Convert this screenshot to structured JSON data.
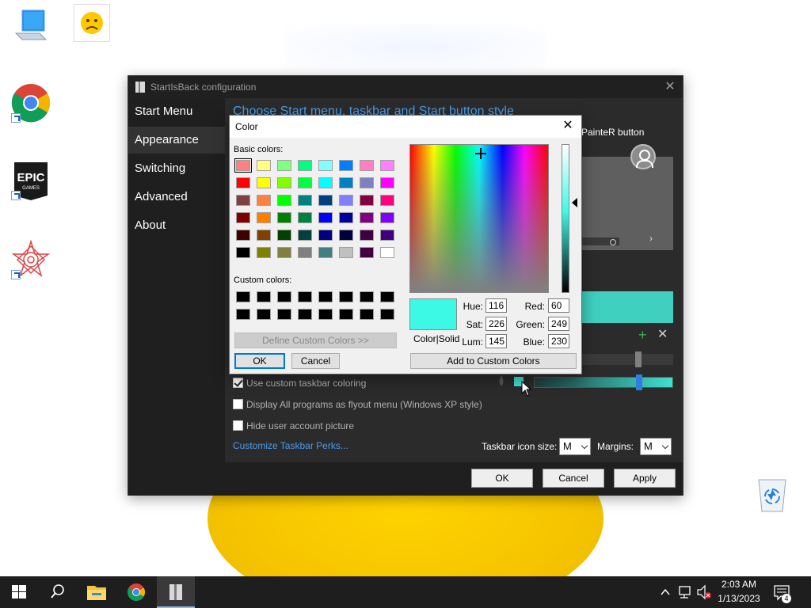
{
  "sib_window": {
    "title": "StartIsBack configuration",
    "close_glyph": "✕",
    "nav": [
      "Start Menu",
      "Appearance",
      "Switching",
      "Advanced",
      "About"
    ],
    "active_nav": "Appearance",
    "heading": "Choose Start menu, taskbar and Start button style",
    "painter_label": "PainteR button",
    "checkboxes": [
      {
        "label": "Use custom taskbar coloring",
        "checked": true
      },
      {
        "label": "Display All programs as flyout menu (Windows XP style)",
        "checked": false
      },
      {
        "label": "Hide user account picture",
        "checked": false
      }
    ],
    "link": "Customize Taskbar Perks...",
    "taskbar_icon_size_label": "Taskbar icon size:",
    "taskbar_icon_size_value": "M",
    "margins_label": "Margins:",
    "margins_value": "M",
    "buttons": {
      "ok": "OK",
      "cancel": "Cancel",
      "apply": "Apply"
    },
    "accent_color": "#3fd0c0"
  },
  "color_dialog": {
    "title": "Color",
    "close_glyph": "✕",
    "basic_colors_label": "Basic colors:",
    "custom_colors_label": "Custom colors:",
    "basic_colors": [
      [
        "#ff8080",
        "#ffff80",
        "#80ff80",
        "#00ff80",
        "#80ffff",
        "#0080ff",
        "#ff80c0",
        "#ff80ff"
      ],
      [
        "#ff0000",
        "#ffff00",
        "#80ff00",
        "#00ff40",
        "#00ffff",
        "#0080c0",
        "#8080c0",
        "#ff00ff"
      ],
      [
        "#804040",
        "#ff8040",
        "#00ff00",
        "#008080",
        "#004080",
        "#8080ff",
        "#800040",
        "#ff0080"
      ],
      [
        "#800000",
        "#ff8000",
        "#008000",
        "#008040",
        "#0000ff",
        "#0000a0",
        "#800080",
        "#8000ff"
      ],
      [
        "#400000",
        "#804000",
        "#004000",
        "#004040",
        "#000080",
        "#000040",
        "#400040",
        "#400080"
      ],
      [
        "#000000",
        "#808000",
        "#808040",
        "#808080",
        "#408080",
        "#c0c0c0",
        "#400040",
        "#ffffff"
      ]
    ],
    "custom_colors": [
      "#000000",
      "#000000",
      "#000000",
      "#000000",
      "#000000",
      "#000000",
      "#000000",
      "#000000",
      "#000000",
      "#000000",
      "#000000",
      "#000000",
      "#000000",
      "#000000",
      "#000000",
      "#000000"
    ],
    "define_custom_button": "Define Custom Colors >>",
    "ok_button": "OK",
    "cancel_button": "Cancel",
    "color_solid_label": "Color|Solid",
    "selected_color": "#3cf9e6",
    "fields": {
      "hue": {
        "label": "Hue:",
        "value": "116"
      },
      "sat": {
        "label": "Sat:",
        "value": "226"
      },
      "lum": {
        "label": "Lum:",
        "value": "145"
      },
      "red": {
        "label": "Red:",
        "value": "60"
      },
      "green": {
        "label": "Green:",
        "value": "249"
      },
      "blue": {
        "label": "Blue:",
        "value": "230"
      }
    },
    "add_custom_button": "Add to Custom Colors"
  },
  "taskbar": {
    "time": "2:03 AM",
    "date": "1/13/2023",
    "notification_count": "4",
    "apps": [
      "start-icon",
      "search-icon",
      "file-explorer-icon",
      "chrome-icon",
      "startisback-icon"
    ]
  },
  "desktop": {
    "icons": [
      "this-pc-icon",
      "sad-face-file-icon",
      "chrome-shortcut-icon",
      "epic-games-icon",
      "app-shortcut-icon",
      "recycle-bin-icon"
    ],
    "epic_text": "EPIC",
    "epic_subtext": "GAMES"
  }
}
